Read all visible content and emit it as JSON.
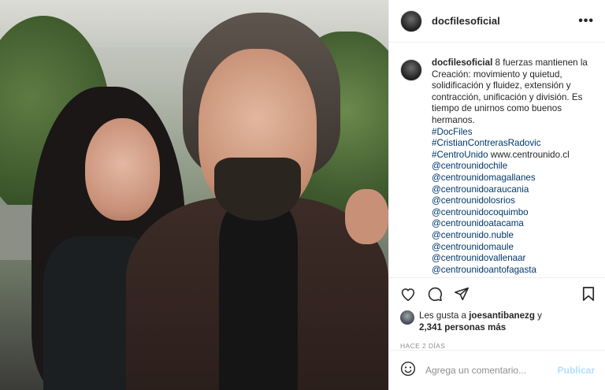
{
  "post": {
    "username": "docfilesoficial",
    "caption_text": "8 fuerzas mantienen la Creación: movimiento y quietud, solidificación y fluidez, extensión y contracción, unificación y división. Es tiempo de unirnos como buenos hermanos.",
    "tags": [
      "#DocFiles",
      "#CristianContrerasRadovic"
    ],
    "tag_centrounido": "#CentroUnido",
    "website": "www.centrounido.cl",
    "mentions": [
      "@centrounidochile",
      "@centrounidomagallanes",
      "@centrounidoaraucania",
      "@centrounidolosrios",
      "@centrounidocoquimbo",
      "@centrounidoatacama",
      "@centrounido.nuble",
      "@centrounidomaule",
      "@centrounidovallenaar",
      "@centrounidoantofagasta"
    ],
    "likes_prefix": "Les gusta a",
    "likes_user": "joesantibanezg",
    "likes_and": "y",
    "likes_count": "2,341 personas más",
    "time_ago": "HACE 2 DÍAS"
  },
  "comment": {
    "placeholder": "Agrega un comentario...",
    "publish_label": "Publicar"
  },
  "icons": {
    "more": "more-options-icon",
    "like": "heart-icon",
    "comment": "comment-icon",
    "share": "share-icon",
    "save": "bookmark-icon",
    "emoji": "emoji-icon"
  },
  "colors": {
    "link": "#00376b",
    "publish_disabled": "#b2dffc",
    "muted": "#8e8e8e"
  }
}
